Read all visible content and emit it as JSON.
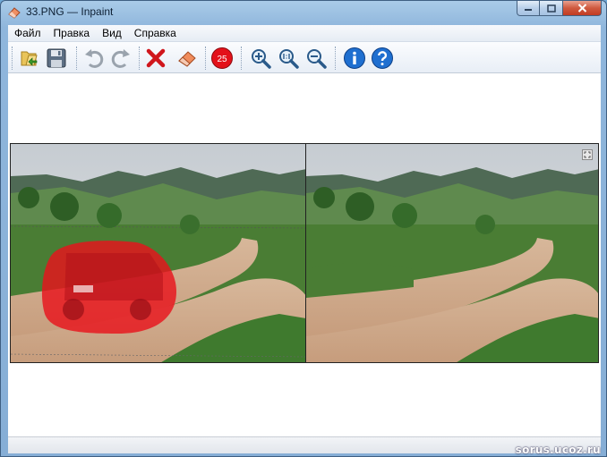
{
  "window": {
    "title": "33.PNG — Inpaint"
  },
  "menu": {
    "items": [
      "Файл",
      "Правка",
      "Вид",
      "Справка"
    ]
  },
  "toolbar": {
    "buttons": [
      {
        "name": "open-file",
        "icon": "folder-open-icon"
      },
      {
        "name": "save",
        "icon": "floppy-disk-icon"
      },
      {
        "name": "undo",
        "icon": "undo-arrow-icon"
      },
      {
        "name": "redo",
        "icon": "redo-arrow-icon"
      },
      {
        "name": "clear-selection",
        "icon": "red-x-icon"
      },
      {
        "name": "eraser",
        "icon": "eraser-icon"
      },
      {
        "name": "brush-size",
        "icon": "red-circle-icon"
      },
      {
        "name": "zoom-in",
        "icon": "zoom-in-icon"
      },
      {
        "name": "zoom-actual",
        "icon": "zoom-1to1-icon"
      },
      {
        "name": "zoom-out",
        "icon": "zoom-out-icon"
      },
      {
        "name": "info",
        "icon": "info-icon"
      },
      {
        "name": "help",
        "icon": "help-icon"
      }
    ],
    "brush_size_label": "25"
  },
  "colors": {
    "selection_mask": "#e8141c",
    "titlebar": "#a9cbe8",
    "accent_blue": "#1f6fd0"
  },
  "watermark": "sorus.ucoz.ru"
}
